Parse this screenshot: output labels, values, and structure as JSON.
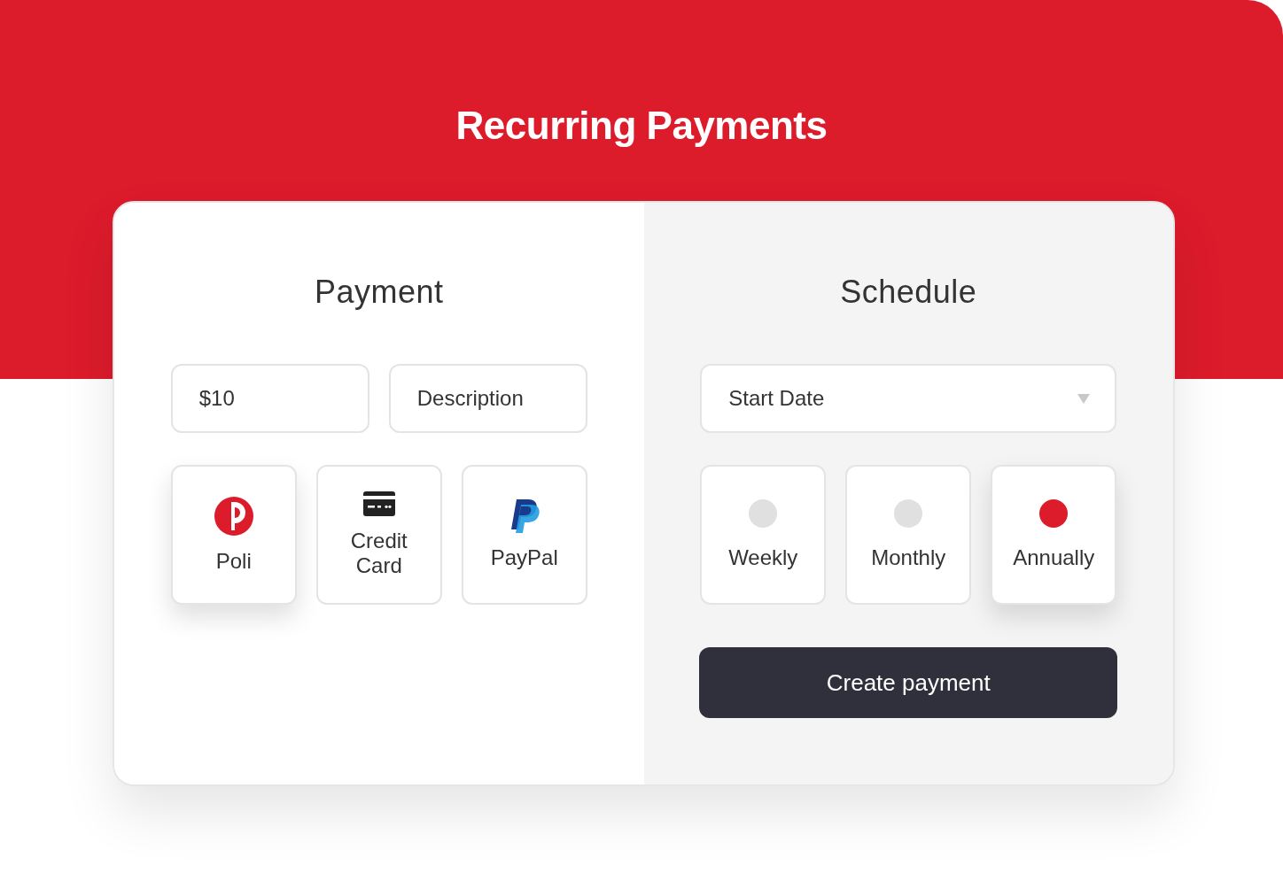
{
  "title": "Recurring Payments",
  "payment": {
    "heading": "Payment",
    "amount": {
      "value": "$10"
    },
    "description": {
      "placeholder": "Description"
    },
    "methods": [
      {
        "kind": "poli",
        "label": "Poli",
        "selected": true
      },
      {
        "kind": "card",
        "label": "Credit Card",
        "selected": false
      },
      {
        "kind": "paypal",
        "label": "PayPal",
        "selected": false
      }
    ]
  },
  "schedule": {
    "heading": "Schedule",
    "start_date": {
      "placeholder": "Start Date"
    },
    "frequencies": [
      {
        "label": "Weekly",
        "selected": false
      },
      {
        "label": "Monthly",
        "selected": false
      },
      {
        "label": "Annually",
        "selected": true
      }
    ],
    "button": "Create payment"
  }
}
